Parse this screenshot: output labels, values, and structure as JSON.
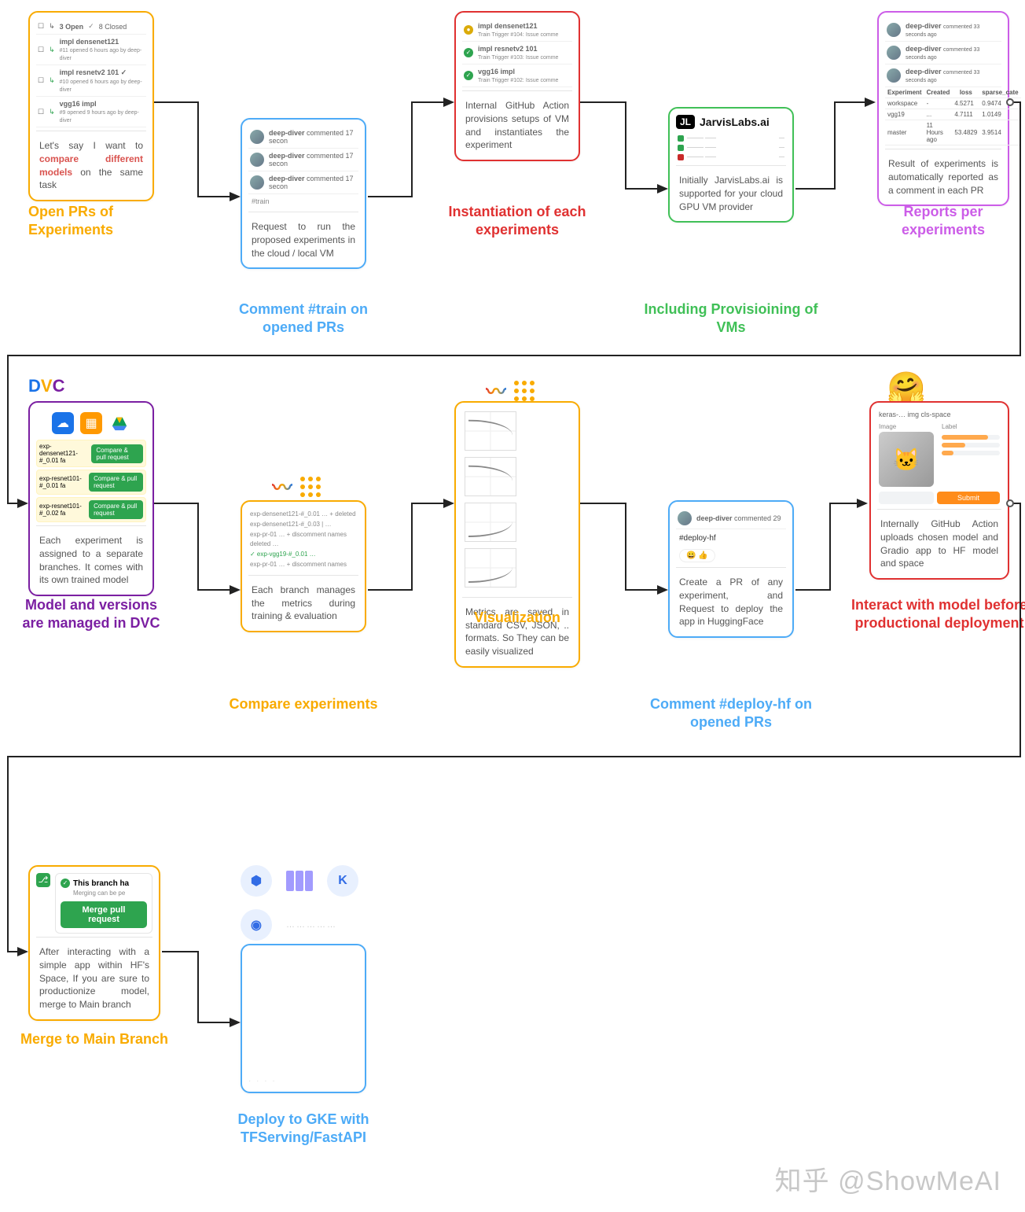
{
  "row1": {
    "open_prs": {
      "header": {
        "open_count": "3 Open",
        "closed_count": "8 Closed"
      },
      "items": [
        {
          "title": "impl densenet121",
          "meta": "#11 opened 6 hours ago by deep-diver"
        },
        {
          "title": "impl resnetv2 101 ✓",
          "meta": "#10 opened 6 hours ago by deep-diver"
        },
        {
          "title": "vgg16 impl",
          "meta": "#9 opened 9 hours ago by deep-diver"
        }
      ],
      "desc_prefix": "Let's say I want to ",
      "desc_highlight": "compare different models",
      "desc_suffix": " on the same task",
      "caption": "Open PRs of Experiments"
    },
    "comment_train": {
      "comments": [
        {
          "user": "deep-diver",
          "meta": "commented 17 secon"
        },
        {
          "user": "deep-diver",
          "meta": "commented 17 secon"
        },
        {
          "user": "deep-diver",
          "meta": "commented 17 secon"
        }
      ],
      "extra": "#train",
      "desc": "Request to run the proposed experiments in the cloud / local VM",
      "caption": "Comment #train on opened PRs"
    },
    "instantiation": {
      "items": [
        {
          "status": "warn",
          "title": "impl densenet121",
          "meta": "Train Trigger #104: Issue comme"
        },
        {
          "status": "ok",
          "title": "impl resnetv2 101",
          "meta": "Train Trigger #103: Issue comme"
        },
        {
          "status": "ok",
          "title": "vgg16 impl",
          "meta": "Train Trigger #102: Issue comme"
        }
      ],
      "desc": "Internal GitHub Action provisions setups of VM and instantiates the experiment",
      "caption": "Instantiation of each experiments"
    },
    "jarvis": {
      "logo_text": "JarvisLabs.ai",
      "desc": "Initially JarvisLabs.ai is supported for your cloud GPU VM provider",
      "caption": "Including Provisioining of VMs"
    },
    "reports": {
      "comments": [
        {
          "user": "deep-diver",
          "meta": "commented 33 seconds ago"
        },
        {
          "user": "deep-diver",
          "meta": "commented 33 seconds ago"
        },
        {
          "user": "deep-diver",
          "meta": "commented 33 seconds ago"
        }
      ],
      "table": {
        "headers": [
          "Experiment",
          "Created",
          "loss",
          "sparse_cate"
        ],
        "rows": [
          [
            "workspace",
            "-",
            "4.5271",
            "0.9474"
          ],
          [
            "vgg19",
            "...",
            "4.7111",
            "1.0149"
          ],
          [
            "master",
            "11 Hours ago",
            "53.4829",
            "3.9514"
          ]
        ]
      },
      "desc": "Result of experiments is automatically reported as a comment in each PR",
      "caption": "Reports per experiments"
    }
  },
  "row2": {
    "dvc": {
      "logo": "DVC",
      "branches": [
        {
          "name": "exp-densenet121-#_0.01 fa",
          "btn": "Compare & pull request"
        },
        {
          "name": "exp-resnet101-#_0.01 fa",
          "btn": "Compare & pull request"
        },
        {
          "name": "exp-resnet101-#_0.02 fa",
          "btn": "Compare & pull request"
        }
      ],
      "desc": "Each experiment is assigned to a separate branches. It comes with its own trained model",
      "caption": "Model and versions are managed in DVC"
    },
    "compare": {
      "rows": [
        "exp-densenet121-#_0.01  … + deleted",
        "exp-densenet121-#_0.03  |  …",
        "exp-pr-01  …  + discomment names",
        "deleted  …",
        "✓ exp-vgg19-#_0.01  …",
        "exp-pr-01  …  + discomment names"
      ],
      "desc": "Each branch manages the metrics during training & evaluation",
      "caption": "Compare experiments"
    },
    "visualization": {
      "desc": "Metrics are saved in standard CSV, JSON, .. formats. So They can be easily visualized",
      "caption": "Visualization"
    },
    "deploy_hf": {
      "user": "deep-diver",
      "user_action": "commented 29",
      "comment_body": "#deploy-hf",
      "reactions": "😀 👍",
      "desc": "Create a PR of any experiment, and Request to deploy the app in HuggingFace",
      "caption": "Comment #deploy-hf on opened PRs"
    },
    "interact": {
      "app_title": "keras-… img cls-space",
      "tabs": [
        "Image",
        "Label"
      ],
      "submit_btn": "Submit",
      "desc": "Internally GitHub Action uploads chosen model and Gradio app to HF model and space",
      "caption": "Interact with model before productional deployment"
    }
  },
  "row3": {
    "merge": {
      "banner_title": "This branch ha",
      "banner_sub": "Merging can be pe",
      "btn": "Merge pull request",
      "desc": "After interacting with a simple app within HF's Space, If you are sure to productionize model, merge to Main branch",
      "caption": "Merge to Main Branch"
    },
    "gke": {
      "caption": "Deploy to GKE with TFServing/FastAPI"
    }
  },
  "watermark": "知乎 @ShowMeAI"
}
